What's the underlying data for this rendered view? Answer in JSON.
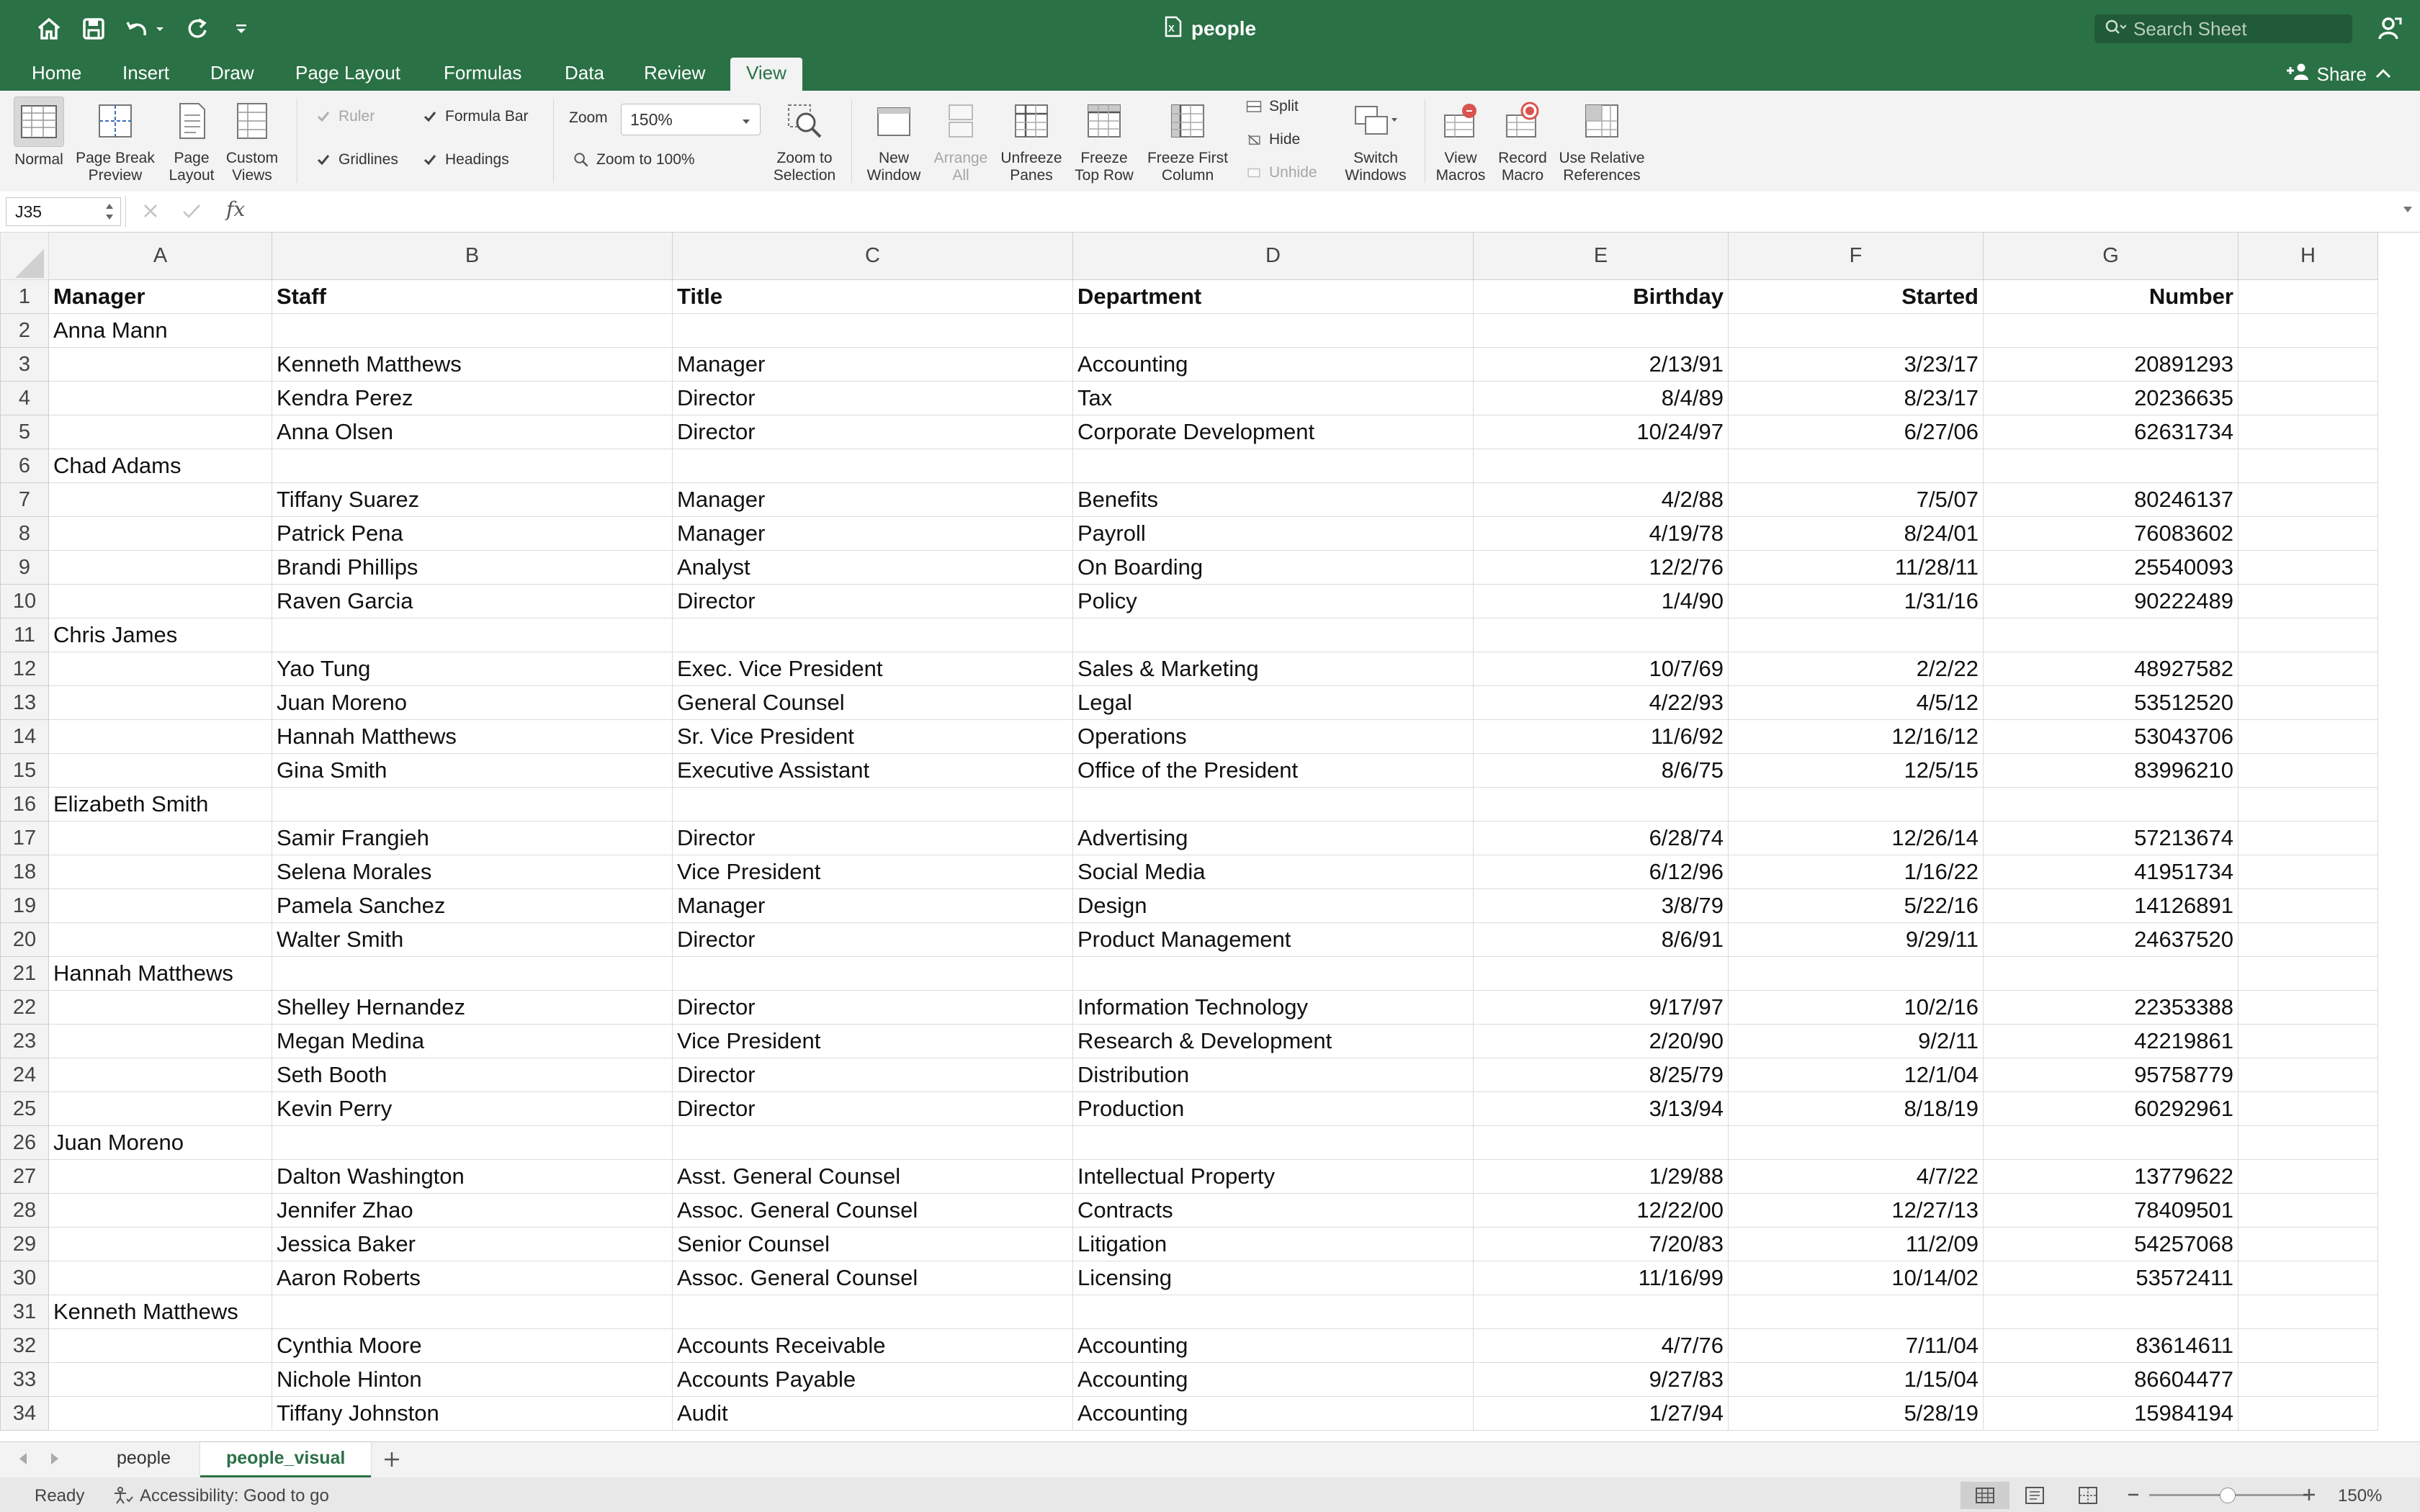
{
  "window": {
    "doc_title": "people"
  },
  "search": {
    "placeholder": "Search Sheet"
  },
  "ribbon_tabs": [
    "Home",
    "Insert",
    "Draw",
    "Page Layout",
    "Formulas",
    "Data",
    "Review",
    "View"
  ],
  "active_tab": "View",
  "share_label": "Share",
  "view_ribbon": {
    "normal": "Normal",
    "page_break_1": "Page Break",
    "page_break_2": "Preview",
    "page_layout_1": "Page",
    "page_layout_2": "Layout",
    "custom_views_1": "Custom",
    "custom_views_2": "Views",
    "ruler": "Ruler",
    "formula_bar": "Formula Bar",
    "gridlines": "Gridlines",
    "headings": "Headings",
    "zoom_label": "Zoom",
    "zoom_value": "150%",
    "zoom_100": "Zoom to 100%",
    "zoom_sel_1": "Zoom to",
    "zoom_sel_2": "Selection",
    "new_window_1": "New",
    "new_window_2": "Window",
    "arrange_1": "Arrange",
    "arrange_2": "All",
    "unfreeze_1": "Unfreeze",
    "unfreeze_2": "Panes",
    "freeze_top_1": "Freeze",
    "freeze_top_2": "Top Row",
    "freeze_first_1": "Freeze First",
    "freeze_first_2": "Column",
    "split": "Split",
    "hide": "Hide",
    "unhide": "Unhide",
    "switch_1": "Switch",
    "switch_2": "Windows",
    "view_macros_1": "View",
    "view_macros_2": "Macros",
    "record_macro_1": "Record",
    "record_macro_2": "Macro",
    "relative_1": "Use Relative",
    "relative_2": "References"
  },
  "formula_bar": {
    "name_box": "J35",
    "fx": "fx",
    "formula": ""
  },
  "columns": [
    "A",
    "B",
    "C",
    "D",
    "E",
    "F",
    "G",
    "H"
  ],
  "rows": [
    [
      "Manager",
      "Staff",
      "Title",
      "Department",
      "Birthday",
      "Started",
      "Number"
    ],
    [
      "Anna Mann",
      "",
      "",
      "",
      "",
      "",
      ""
    ],
    [
      "",
      "Kenneth Matthews",
      "Manager",
      "Accounting",
      "2/13/91",
      "3/23/17",
      "20891293"
    ],
    [
      "",
      "Kendra Perez",
      "Director",
      "Tax",
      "8/4/89",
      "8/23/17",
      "20236635"
    ],
    [
      "",
      "Anna Olsen",
      "Director",
      "Corporate Development",
      "10/24/97",
      "6/27/06",
      "62631734"
    ],
    [
      "Chad Adams",
      "",
      "",
      "",
      "",
      "",
      ""
    ],
    [
      "",
      "Tiffany Suarez",
      "Manager",
      "Benefits",
      "4/2/88",
      "7/5/07",
      "80246137"
    ],
    [
      "",
      "Patrick Pena",
      "Manager",
      "Payroll",
      "4/19/78",
      "8/24/01",
      "76083602"
    ],
    [
      "",
      "Brandi Phillips",
      "Analyst",
      "On Boarding",
      "12/2/76",
      "11/28/11",
      "25540093"
    ],
    [
      "",
      "Raven Garcia",
      "Director",
      "Policy",
      "1/4/90",
      "1/31/16",
      "90222489"
    ],
    [
      "Chris James",
      "",
      "",
      "",
      "",
      "",
      ""
    ],
    [
      "",
      "Yao Tung",
      "Exec. Vice President",
      "Sales & Marketing",
      "10/7/69",
      "2/2/22",
      "48927582"
    ],
    [
      "",
      "Juan Moreno",
      "General Counsel",
      "Legal",
      "4/22/93",
      "4/5/12",
      "53512520"
    ],
    [
      "",
      "Hannah Matthews",
      "Sr. Vice President",
      "Operations",
      "11/6/92",
      "12/16/12",
      "53043706"
    ],
    [
      "",
      "Gina Smith",
      "Executive Assistant",
      "Office of the President",
      "8/6/75",
      "12/5/15",
      "83996210"
    ],
    [
      "Elizabeth Smith",
      "",
      "",
      "",
      "",
      "",
      ""
    ],
    [
      "",
      "Samir Frangieh",
      "Director",
      "Advertising",
      "6/28/74",
      "12/26/14",
      "57213674"
    ],
    [
      "",
      "Selena Morales",
      "Vice President",
      "Social Media",
      "6/12/96",
      "1/16/22",
      "41951734"
    ],
    [
      "",
      "Pamela Sanchez",
      "Manager",
      "Design",
      "3/8/79",
      "5/22/16",
      "14126891"
    ],
    [
      "",
      "Walter Smith",
      "Director",
      "Product Management",
      "8/6/91",
      "9/29/11",
      "24637520"
    ],
    [
      "Hannah Matthews",
      "",
      "",
      "",
      "",
      "",
      ""
    ],
    [
      "",
      "Shelley Hernandez",
      "Director",
      "Information Technology",
      "9/17/97",
      "10/2/16",
      "22353388"
    ],
    [
      "",
      "Megan Medina",
      "Vice President",
      "Research & Development",
      "2/20/90",
      "9/2/11",
      "42219861"
    ],
    [
      "",
      "Seth Booth",
      "Director",
      "Distribution",
      "8/25/79",
      "12/1/04",
      "95758779"
    ],
    [
      "",
      "Kevin Perry",
      "Director",
      "Production",
      "3/13/94",
      "8/18/19",
      "60292961"
    ],
    [
      "Juan Moreno",
      "",
      "",
      "",
      "",
      "",
      ""
    ],
    [
      "",
      "Dalton Washington",
      "Asst. General Counsel",
      "Intellectual Property",
      "1/29/88",
      "4/7/22",
      "13779622"
    ],
    [
      "",
      "Jennifer Zhao",
      "Assoc. General Counsel",
      "Contracts",
      "12/22/00",
      "12/27/13",
      "78409501"
    ],
    [
      "",
      "Jessica Baker",
      "Senior Counsel",
      "Litigation",
      "7/20/83",
      "11/2/09",
      "54257068"
    ],
    [
      "",
      "Aaron Roberts",
      "Assoc. General Counsel",
      "Licensing",
      "11/16/99",
      "10/14/02",
      "53572411"
    ],
    [
      "Kenneth Matthews",
      "",
      "",
      "",
      "",
      "",
      ""
    ],
    [
      "",
      "Cynthia Moore",
      "Accounts Receivable",
      "Accounting",
      "4/7/76",
      "7/11/04",
      "83614611"
    ],
    [
      "",
      "Nichole Hinton",
      "Accounts Payable",
      "Accounting",
      "9/27/83",
      "1/15/04",
      "86604477"
    ],
    [
      "",
      "Tiffany Johnston",
      "Audit",
      "Accounting",
      "1/27/94",
      "5/28/19",
      "15984194"
    ]
  ],
  "sheet_tabs": [
    "people",
    "people_visual"
  ],
  "active_sheet": "people_visual",
  "status": {
    "ready": "Ready",
    "accessibility": "Accessibility: Good to go",
    "zoom": "150%"
  },
  "colors": {
    "brand": "#2a7145",
    "ribbon": "#f3f3f3",
    "grid": "#dcdcdc"
  }
}
